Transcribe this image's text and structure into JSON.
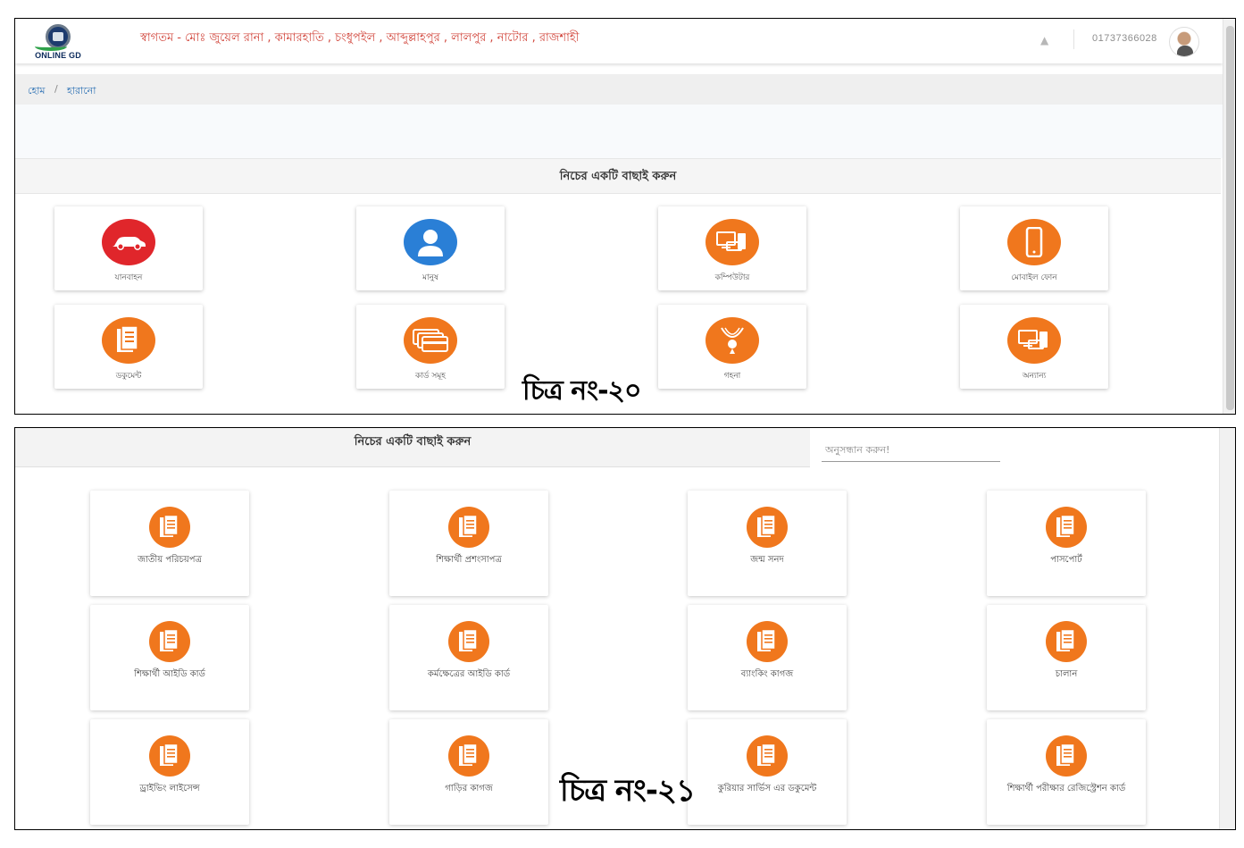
{
  "screen1": {
    "logo_text": "ONLINE GD",
    "welcome": "স্বাগতম - মোঃ জুয়েল রানা , কামারহাতি , চংধুপইল , আব্দুল্লাহপুর , লালপুর , নাটোর , রাজশাহী",
    "phone": "01737366028",
    "breadcrumb": {
      "home": "হোম",
      "separator": "/",
      "current": "হারানো"
    },
    "panel_title": "নিচের একটি বাছাই করুন",
    "categories": [
      {
        "label": "যানবাহন",
        "icon": "car-icon",
        "color": "#e0262b"
      },
      {
        "label": "মানুষ",
        "icon": "person-icon",
        "color": "#2a7fd6"
      },
      {
        "label": "কম্পিউটার",
        "icon": "computer-icon",
        "color": "#f0771d"
      },
      {
        "label": "মোবাইল ফোন",
        "icon": "mobile-phone-icon",
        "color": "#f0771d"
      },
      {
        "label": "ডকুমেন্ট",
        "icon": "document-icon",
        "color": "#f0771d"
      },
      {
        "label": "কার্ড সমূহ",
        "icon": "cards-icon",
        "color": "#f0771d"
      },
      {
        "label": "গহনা",
        "icon": "jewelry-icon",
        "color": "#f0771d"
      },
      {
        "label": "অন্যান্য",
        "icon": "other-devices-icon",
        "color": "#f0771d"
      }
    ],
    "figure_caption": "চিত্র নং-২০"
  },
  "screen2": {
    "panel_title": "নিচের একটি বাছাই করুন",
    "search_placeholder": "অনুসন্ধান করুন!",
    "documents": [
      {
        "label": "জাতীয় পরিচয়পত্র"
      },
      {
        "label": "শিক্ষার্থী প্রশংসাপত্র"
      },
      {
        "label": "জন্ম সনদ"
      },
      {
        "label": "পাসপোর্ট"
      },
      {
        "label": "শিক্ষার্থী আইডি কার্ড"
      },
      {
        "label": "কর্মক্ষেত্রের আইডি কার্ড"
      },
      {
        "label": "ব্যাংকিং কাগজ"
      },
      {
        "label": "চালান"
      },
      {
        "label": "ড্রাইভিং লাইসেন্স"
      },
      {
        "label": "গাড়ির কাগজ"
      },
      {
        "label": "কুরিয়ার সার্ভিস এর ডকুমেন্ট"
      },
      {
        "label": "শিক্ষার্থী পরীক্ষার রেজিস্ট্রেশন কার্ড"
      }
    ],
    "figure_caption": "চিত্র নং-২১"
  },
  "colors": {
    "accent_orange": "#f0771d",
    "welcome_red": "#d1453b",
    "link_blue": "#2a6fb3"
  }
}
